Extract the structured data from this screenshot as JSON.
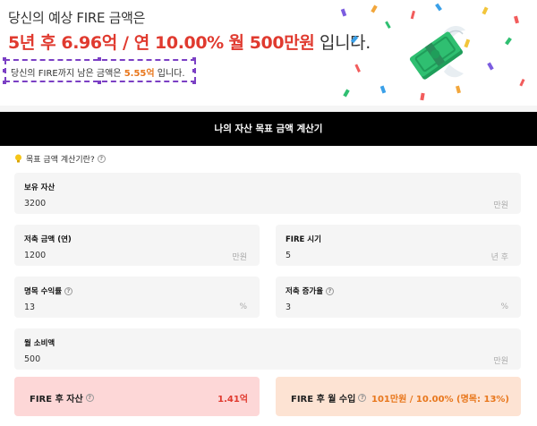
{
  "hero": {
    "line1": "당신의 예상 FIRE 금액은",
    "years": "5년 후 6.96억",
    "sep1": " / ",
    "rate": "연 10.00%",
    "sep2": " ",
    "monthly": "월 500만원",
    "suffix": " 입니다.",
    "remaining_prefix": "당신의 FIRE까지 남은 금액은 ",
    "remaining_value": "5.55억",
    "remaining_suffix": " 입니다."
  },
  "calculator": {
    "title": "나의 자산 목표 금액 계산기",
    "guide": "목표 금액 계산기란?",
    "help_glyph": "?",
    "fields": {
      "assets": {
        "label": "보유 자산",
        "value": "3200",
        "unit": "만원"
      },
      "savings": {
        "label": "저축 금액 (연)",
        "value": "1200",
        "unit": "만원"
      },
      "fire_time": {
        "label": "FIRE 시기",
        "value": "5",
        "unit": "년 후"
      },
      "nominal_return": {
        "label": "명목 수익률",
        "value": "13",
        "unit": "%"
      },
      "savings_growth": {
        "label": "저축 증가율",
        "value": "3",
        "unit": "%"
      },
      "monthly_spend": {
        "label": "월 소비액",
        "value": "500",
        "unit": "만원"
      }
    },
    "results": {
      "assets_after": {
        "label": "FIRE 후 자산",
        "value": "1.41억"
      },
      "monthly_income": {
        "label": "FIRE 후 월 수입",
        "value": "101만원 / 10.00% (명목: 13%)"
      }
    }
  },
  "colors": {
    "accent_red": "#e03a2f",
    "accent_orange": "#e8771c",
    "selection_purple": "#7b3fc4",
    "header_black": "#000000",
    "result_red_bg": "#fdd7d7",
    "result_peach_bg": "#fde3d3"
  },
  "icons": {
    "money": "flying-money-icon",
    "guide": "lightbulb-icon",
    "help": "question-circle-icon"
  }
}
